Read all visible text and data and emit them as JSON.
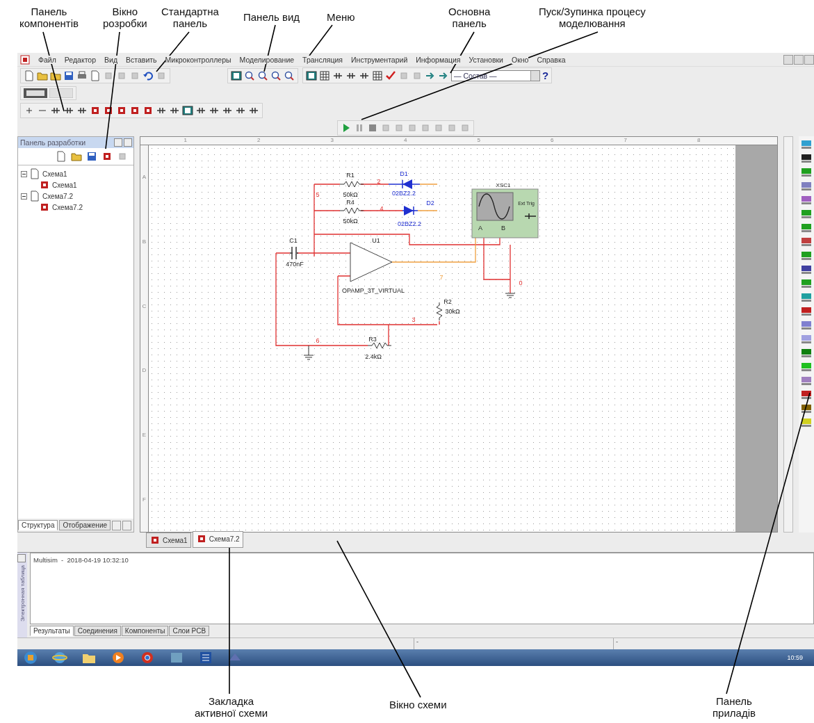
{
  "annotations": {
    "top": [
      {
        "text": "Панель\nкомпонентів"
      },
      {
        "text": "Вікно\nрозробки"
      },
      {
        "text": "Стандартна\nпанель"
      },
      {
        "text": "Панель вид"
      },
      {
        "text": "Меню"
      },
      {
        "text": "Основна\nпанель"
      },
      {
        "text": "Пуск/Зупинка процесу\nмоделювання"
      }
    ],
    "bottom": [
      {
        "text": "Закладка\nактивної схеми"
      },
      {
        "text": "Вікно схеми"
      },
      {
        "text": "Панель\nприладів"
      }
    ]
  },
  "menu": [
    "Файл",
    "Редактор",
    "Вид",
    "Вставить",
    "Микроконтроллеры",
    "Моделирование",
    "Трансляция",
    "Инструментарий",
    "Информация",
    "Установки",
    "Окно",
    "Справка"
  ],
  "toolbar": {
    "dropdown": {
      "value": "— Состав —"
    },
    "help": "?"
  },
  "design_panel": {
    "title": "Панель разработки",
    "tree": [
      {
        "label": "Схема1",
        "expanded": true,
        "children": [
          {
            "label": "Схема1"
          }
        ]
      },
      {
        "label": "Схема7.2",
        "expanded": true,
        "children": [
          {
            "label": "Схема7.2"
          }
        ]
      }
    ],
    "tabs": [
      {
        "label": "Структура",
        "selected": true
      },
      {
        "label": "Отображение",
        "selected": false
      }
    ]
  },
  "ruler": {
    "columns": [
      "1",
      "2",
      "3",
      "4",
      "5",
      "6",
      "7",
      "8"
    ],
    "rows": [
      "A",
      "B",
      "C",
      "D",
      "E",
      "F"
    ]
  },
  "schematic": {
    "components": [
      {
        "ref": "R1",
        "value": "50kΩ"
      },
      {
        "ref": "R4",
        "value": "50kΩ"
      },
      {
        "ref": "D1",
        "value": "02BZ2.2"
      },
      {
        "ref": "D2",
        "value": "02BZ2.2"
      },
      {
        "ref": "C1",
        "value": "470nF"
      },
      {
        "ref": "U1",
        "value": "OPAMP_3T_VIRTUAL"
      },
      {
        "ref": "R2",
        "value": "30kΩ"
      },
      {
        "ref": "R3",
        "value": "2.4kΩ"
      }
    ],
    "nets": [
      "2",
      "5",
      "4",
      "7",
      "3",
      "6",
      "0"
    ],
    "oscilloscope": {
      "ref": "XSC1",
      "trigger": "Ext Trig",
      "channels": [
        "A",
        "B"
      ]
    }
  },
  "sheet_tabs": [
    {
      "label": "Схема1",
      "selected": false
    },
    {
      "label": "Схема7.2",
      "selected": true
    }
  ],
  "output": {
    "side_label": "Электронная таблица",
    "lines": [
      "Multisim  -  2018-04-19 10:32:10"
    ],
    "tabs": [
      {
        "label": "Результаты",
        "selected": true
      },
      {
        "label": "Соединения",
        "selected": false
      },
      {
        "label": "Компоненты",
        "selected": false
      },
      {
        "label": "Слои PCB",
        "selected": false
      }
    ]
  },
  "status_bar": [
    "-",
    "-"
  ],
  "taskbar": {
    "clock": "10:59"
  }
}
